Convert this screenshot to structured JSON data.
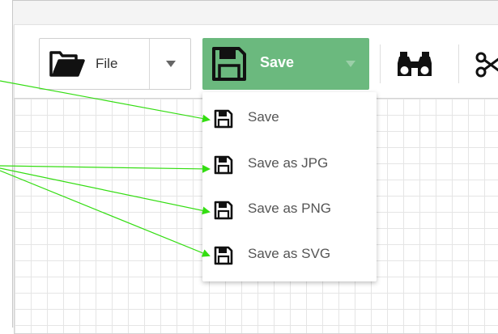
{
  "toolbar": {
    "file_label": "File",
    "save_label": "Save"
  },
  "save_menu": {
    "items": [
      {
        "label": "Save",
        "icon": "floppy-disk-icon"
      },
      {
        "label": "Save as JPG",
        "icon": "floppy-disk-icon"
      },
      {
        "label": "Save as PNG",
        "icon": "floppy-disk-icon"
      },
      {
        "label": "Save as SVG",
        "icon": "floppy-disk-icon"
      }
    ]
  },
  "colors": {
    "save_button_bg": "#6bb97e",
    "annotation_arrow": "#33dd11"
  }
}
